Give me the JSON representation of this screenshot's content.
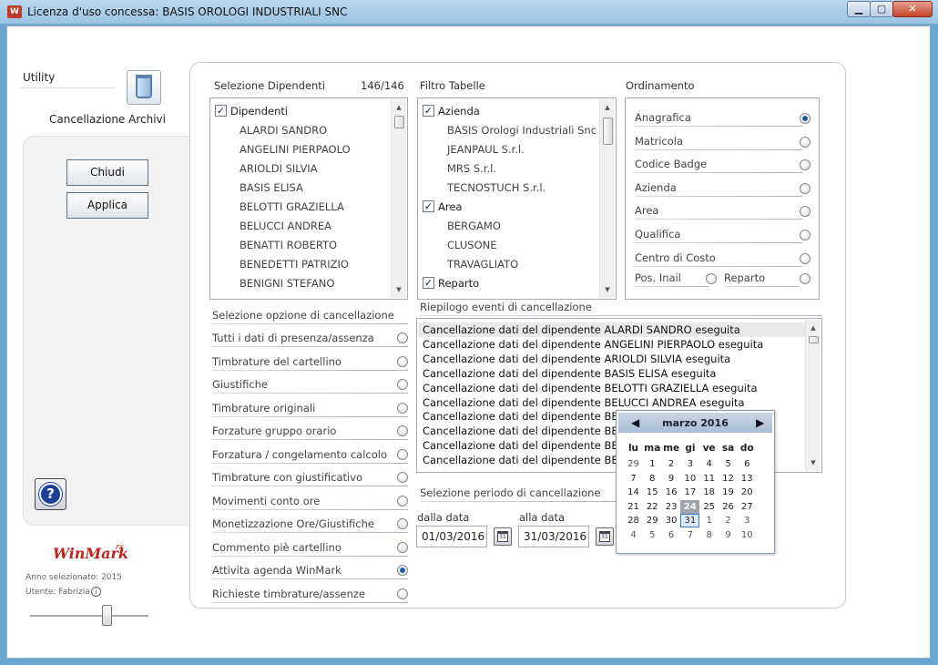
{
  "window": {
    "title": "Licenza d'uso concessa: BASIS OROLOGI INDUSTRIALI SNC",
    "app_icon": "W",
    "min": "▁",
    "max": "▢",
    "close": "✕"
  },
  "sidebar": {
    "utility_label": "Utility",
    "module_title": "Cancellazione Archivi",
    "chiudi": "Chiudi",
    "applica": "Applica",
    "help": "?",
    "logo": "WinMark",
    "logo_sup": "FX",
    "anno": "Anno selezionato: 2015",
    "utente": "Utente: Fabrizia",
    "info": "i"
  },
  "dipendenti": {
    "title": "Selezione Dipendenti",
    "count": "146/146",
    "header": "Dipendenti",
    "check": "✓",
    "items": [
      "ALARDI SANDRO",
      "ANGELINI PIERPAOLO",
      "ARIOLDI SILVIA",
      "BASIS ELISA",
      "BELOTTI GRAZIELLA",
      "BELUCCI ANDREA",
      "BENATTI ROBERTO",
      "BENEDETTI PATRIZIO",
      "BENIGNI STEFANO"
    ]
  },
  "filtro": {
    "title": "Filtro Tabelle",
    "azienda": "Azienda",
    "aziende": [
      "BASIS Orologi Industriali Snc",
      "JEANPAUL S.r.l.",
      "MRS S.r.l.",
      "TECNOSTUCH S.r.l."
    ],
    "area": "Area",
    "aree": [
      "BERGAMO",
      "CLUSONE",
      "TRAVAGLIATO"
    ],
    "reparto": "Reparto"
  },
  "ordinamento": {
    "title": "Ordinamento",
    "options": [
      "Anagrafica",
      "Matricola",
      "Codice Badge",
      "Azienda",
      "Area",
      "Qualifica",
      "Centro di Costo"
    ],
    "pos_inail": "Pos. Inail",
    "reparto": "Reparto",
    "selected": 0
  },
  "opzioni": {
    "title": "Selezione opzione di cancellazione",
    "items": [
      "Tutti i dati di presenza/assenza",
      "Timbrature del cartellino",
      "Giustifiche",
      "Timbrature originali",
      "Forzature gruppo orario",
      "Forzatura / congelamento calcolo",
      "Timbrature con giustificativo",
      "Movimenti conto ore",
      "Monetizzazione Ore/Giustifiche",
      "Commento piè cartellino",
      "Attivita agenda WinMark",
      "Richieste timbrature/assenze"
    ],
    "selected": 10
  },
  "riepilogo": {
    "title": "Riepilogo eventi di cancellazione",
    "events": [
      "Cancellazione dati del dipendente ALARDI SANDRO eseguita",
      "Cancellazione dati del dipendente ANGELINI PIERPAOLO eseguita",
      "Cancellazione dati del dipendente ARIOLDI SILVIA eseguita",
      "Cancellazione dati del dipendente BASIS ELISA eseguita",
      "Cancellazione dati del dipendente BELOTTI GRAZIELLA eseguita",
      "Cancellazione dati del dipendente BELUCCI ANDREA eseguita",
      "Cancellazione dati del dipendente BENA",
      "Cancellazione dati del dipendente BENE",
      "Cancellazione dati del dipendente BENIG",
      "Cancellazione dati del dipendente BENU"
    ]
  },
  "periodo": {
    "title": "Selezione periodo di cancellazione",
    "dalla_label": "dalla data",
    "dalla_value": "01/03/2016",
    "alla_label": "alla data",
    "alla_value": "31/03/2016",
    "cal_icon": "31"
  },
  "calendar": {
    "title": "marzo 2016",
    "prev": "◀",
    "next": "▶",
    "weekdays": [
      "lu",
      "ma",
      "me",
      "gi",
      "ve",
      "sa",
      "do"
    ],
    "weeks": [
      [
        "29",
        "1",
        "2",
        "3",
        "4",
        "5",
        "6"
      ],
      [
        "7",
        "8",
        "9",
        "10",
        "11",
        "12",
        "13"
      ],
      [
        "14",
        "15",
        "16",
        "17",
        "18",
        "19",
        "20"
      ],
      [
        "21",
        "22",
        "23",
        "24",
        "25",
        "26",
        "27"
      ],
      [
        "28",
        "29",
        "30",
        "31",
        "1",
        "2",
        "3"
      ],
      [
        "4",
        "5",
        "6",
        "7",
        "8",
        "9",
        "10"
      ]
    ],
    "today": "24",
    "selected": "31"
  },
  "colors": {
    "accent": "#1e5aa8",
    "titlebar": "#9cc4e4",
    "logo": "#c0231b"
  }
}
